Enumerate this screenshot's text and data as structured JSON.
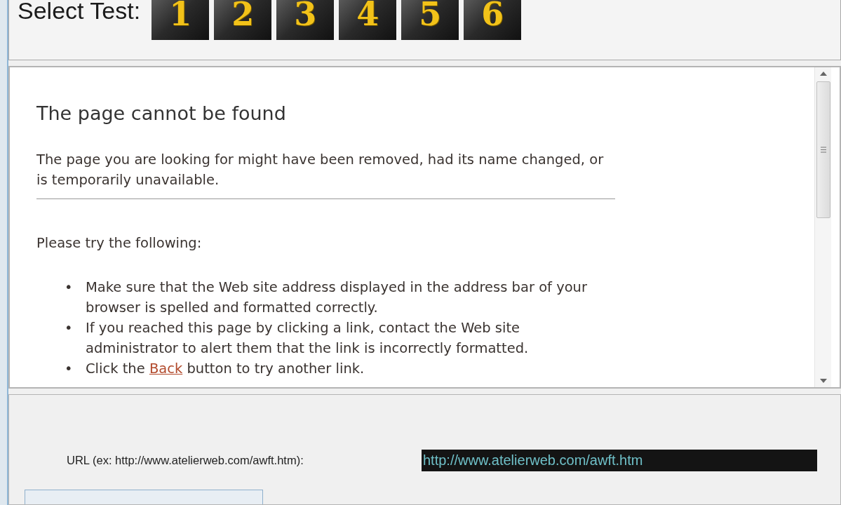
{
  "test_selector": {
    "label": "Select Test:",
    "tests": [
      {
        "label": "1"
      },
      {
        "label": "2"
      },
      {
        "label": "3"
      },
      {
        "label": "4"
      },
      {
        "label": "5"
      },
      {
        "label": "6"
      }
    ]
  },
  "browser": {
    "heading": "The page cannot be found",
    "message": "The page you are looking for might have been removed, had its name changed, or is temporarily unavailable.",
    "prompt": "Please try the following:",
    "suggestions": [
      {
        "marker": "•",
        "text": "Make sure that the Web site address displayed in the address bar of your browser is spelled and formatted correctly."
      },
      {
        "marker": "•",
        "text": "If you reached this page by clicking a link, contact the Web site administrator to alert them that the link is incorrectly formatted."
      },
      {
        "marker": "•",
        "text": "Click the",
        "link": "Back",
        "after": "button to try another link."
      }
    ]
  },
  "url_form": {
    "label": "URL (ex: http://www.atelierweb.com/awft.htm):",
    "value": "http://www.atelierweb.com/awft.htm"
  }
}
